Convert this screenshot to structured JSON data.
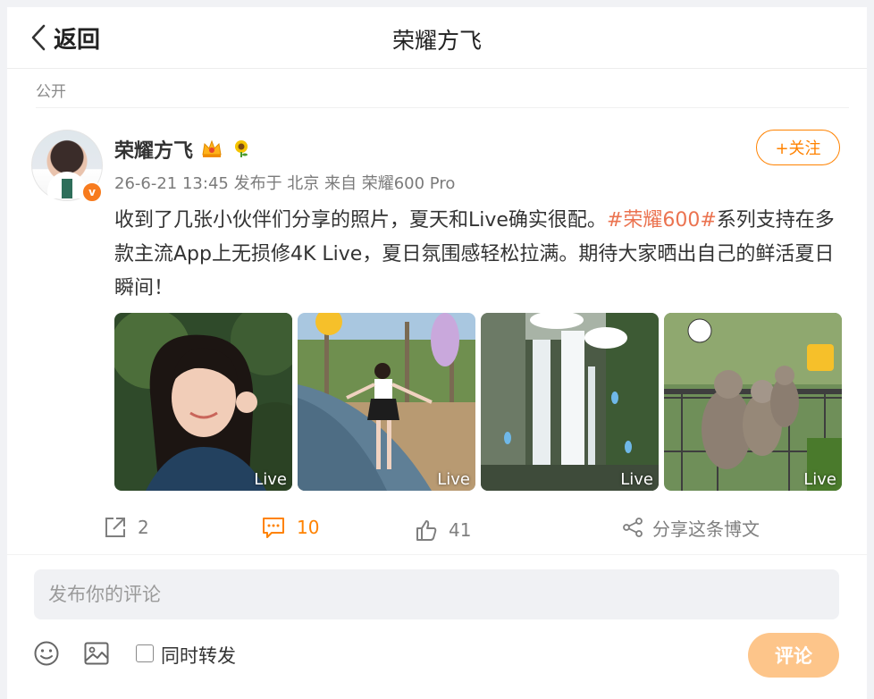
{
  "header": {
    "back_label": "返回",
    "title": "荣耀方飞"
  },
  "post": {
    "visibility": "公开",
    "author": "荣耀方飞",
    "meta": "26-6-21 13:45 发布于 北京 来自 荣耀600 Pro",
    "follow_label": "+关注",
    "text_part1": "收到了几张小伙伴们分享的照片，夏天和Live确实很配。",
    "hashtag": "#荣耀600#",
    "text_part2": "系列支持在多款主流App上无损修4K Live，夏日氛围感轻松拉满。期待大家晒出自己的鲜活夏日瞬间！",
    "images": [
      {
        "live_label": "Live"
      },
      {
        "live_label": "Live"
      },
      {
        "live_label": "Live"
      },
      {
        "live_label": "Live"
      }
    ]
  },
  "actions": {
    "repost_count": "2",
    "comment_count": "10",
    "like_count": "41",
    "share_label": "分享这条博文"
  },
  "composer": {
    "placeholder": "发布你的评论",
    "repost_label": "同时转发",
    "submit_label": "评论"
  },
  "colors": {
    "accent": "#ff8200",
    "hashtag": "#eb7350",
    "comment_active": "#ff8200",
    "submit_disabled": "#fdc58a"
  }
}
